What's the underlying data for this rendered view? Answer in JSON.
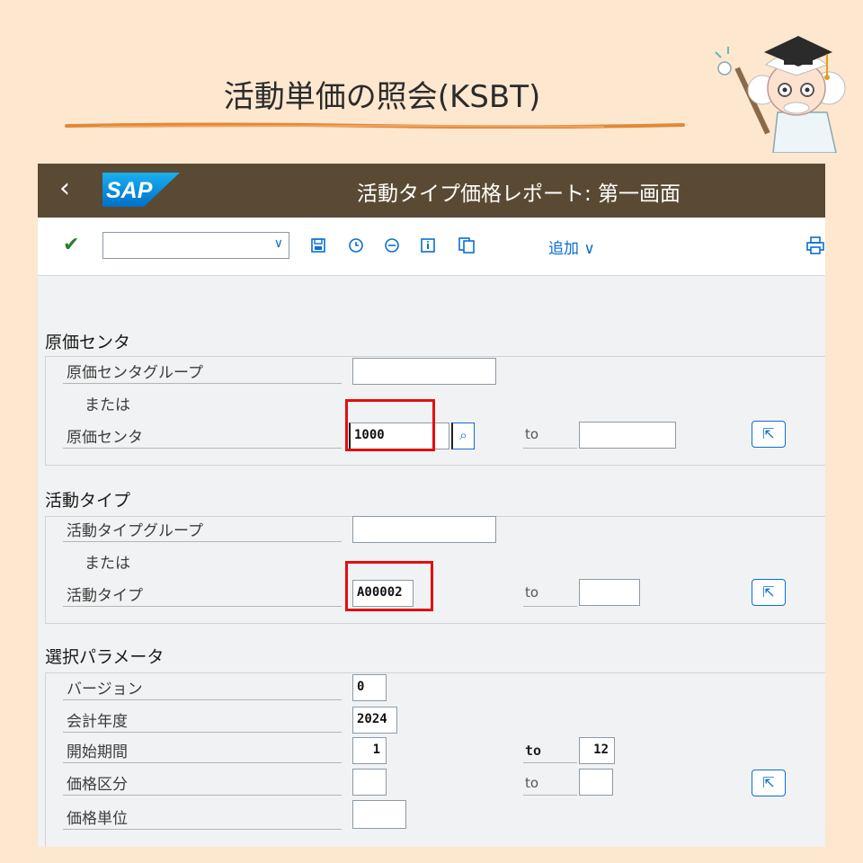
{
  "slide": {
    "title": "活動単価の照会(KSBT)"
  },
  "shell": {
    "back": "‹",
    "logo": "SAP",
    "title": "活動タイプ価格レポート: 第一画面"
  },
  "toolbar": {
    "more_label": "追加 ∨",
    "icons": [
      "check-icon",
      "save-icon",
      "clock-icon",
      "minus-circle-icon",
      "info-icon",
      "copy-icon",
      "print-icon"
    ]
  },
  "cost_center": {
    "section": "原価センタ",
    "group_label": "原価センタグループ",
    "or_label": "または",
    "cc_label": "原価センタ",
    "cc_value": "1000",
    "to_label": "to"
  },
  "activity_type": {
    "section": "活動タイプ",
    "group_label": "活動タイプグループ",
    "or_label": "または",
    "at_label": "活動タイプ",
    "at_value": "A00002",
    "to_label": "to"
  },
  "params": {
    "section": "選択パラメータ",
    "version_label": "バージョン",
    "version_value": "0",
    "fiscal_year_label": "会計年度",
    "fiscal_year_value": "2024",
    "start_period_label": "開始期間",
    "start_period_value": "1",
    "to_label_1": "to",
    "end_period_value": "12",
    "price_ind_label": "価格区分",
    "to_label_2": "to",
    "price_unit_label": "価格単位"
  },
  "colors": {
    "shell": "#5a4a33",
    "accent": "#0a6ed1",
    "highlight": "#e31010",
    "background": "#fde7cf"
  }
}
